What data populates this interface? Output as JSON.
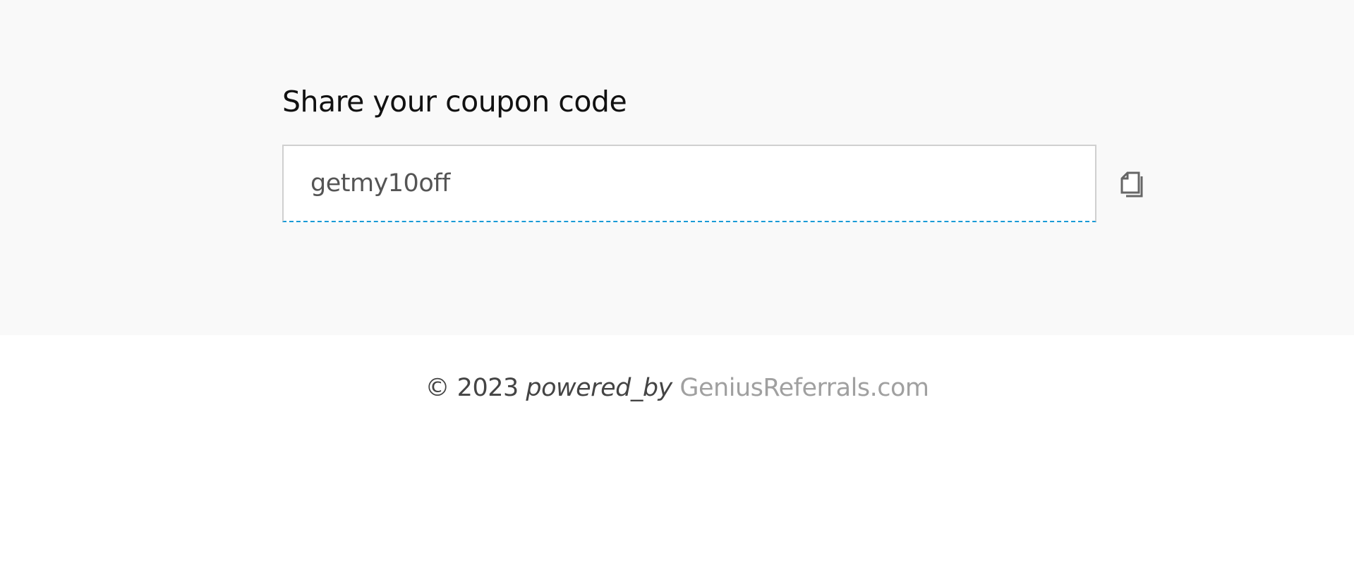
{
  "coupon": {
    "title": "Share your coupon code",
    "code": "getmy10off",
    "copy_icon": "copy-icon"
  },
  "footer": {
    "copyright": "© 2023",
    "powered_by": "powered_by",
    "link": "GeniusReferrals.com"
  },
  "colors": {
    "accent": "#1a9ad6",
    "panel_bg": "#f9f9f9"
  }
}
